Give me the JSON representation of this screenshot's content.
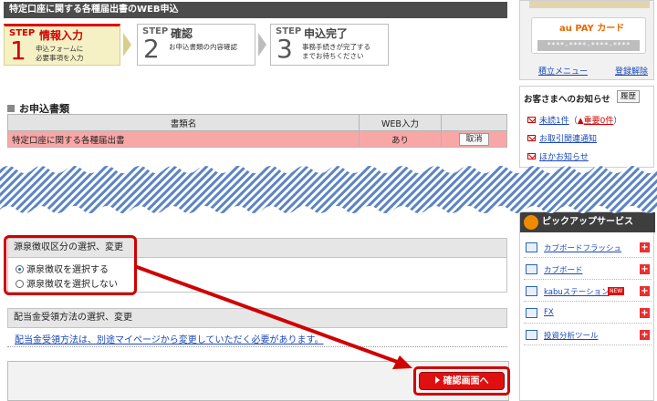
{
  "page": {
    "title": "特定口座に関する各種届出書のWEB申込"
  },
  "steps": [
    {
      "label": "STEP",
      "title": "情報入力",
      "number": "1",
      "desc1": "申込フォームに",
      "desc2": "必要事項を入力"
    },
    {
      "label": "STEP",
      "title": "確認",
      "number": "2",
      "desc1": "お申込書類の内容確認",
      "desc2": ""
    },
    {
      "label": "STEP",
      "title": "申込完了",
      "number": "3",
      "desc1": "事務手続きが完了する",
      "desc2": "までお待ちください"
    }
  ],
  "documents": {
    "heading": "お申込書類",
    "headers": [
      "書類名",
      "WEB入力",
      ""
    ],
    "rows": [
      {
        "name": "特定口座に関する各種届出書",
        "web": "あり",
        "action": "取消"
      }
    ]
  },
  "withholding": {
    "heading": "源泉徴収区分の選択、変更",
    "options": [
      {
        "label": "源泉徴収を選択する",
        "selected": true
      },
      {
        "label": "源泉徴収を選択しない",
        "selected": false
      }
    ]
  },
  "dividend": {
    "heading": "配当金受領方法の選択、変更",
    "note": "配当金受領方法は、別途マイページから変更していただく必要があります。"
  },
  "confirm_button": "確認画面へ",
  "sidebar": {
    "card_brand": "au PAY カード",
    "card_number": "****-****-****-****",
    "card_links": [
      "積立メニュー",
      "登録解除"
    ],
    "notice_heading": "お客さまへのお知らせ",
    "history_button": "履歴",
    "notices": [
      {
        "text": "未読1件",
        "extra": "重要0件"
      },
      {
        "text": "お取引関連通知",
        "extra": ""
      },
      {
        "text": "ほかお知らせ",
        "extra": ""
      }
    ],
    "pickup_heading": "ピックアップサービス",
    "pickup_items": [
      {
        "label": "カブボードフラッシュ",
        "badge": ""
      },
      {
        "label": "カブボード",
        "badge": ""
      },
      {
        "label": "kabuステーション",
        "badge": "NEW"
      },
      {
        "label": "FX",
        "badge": ""
      },
      {
        "label": "投資分析ツール",
        "badge": ""
      }
    ]
  },
  "colors": {
    "accent": "#d00000",
    "highlight_row": "#f8a7a7",
    "title_bar": "#4c4c4c",
    "link": "#1a47b8"
  }
}
